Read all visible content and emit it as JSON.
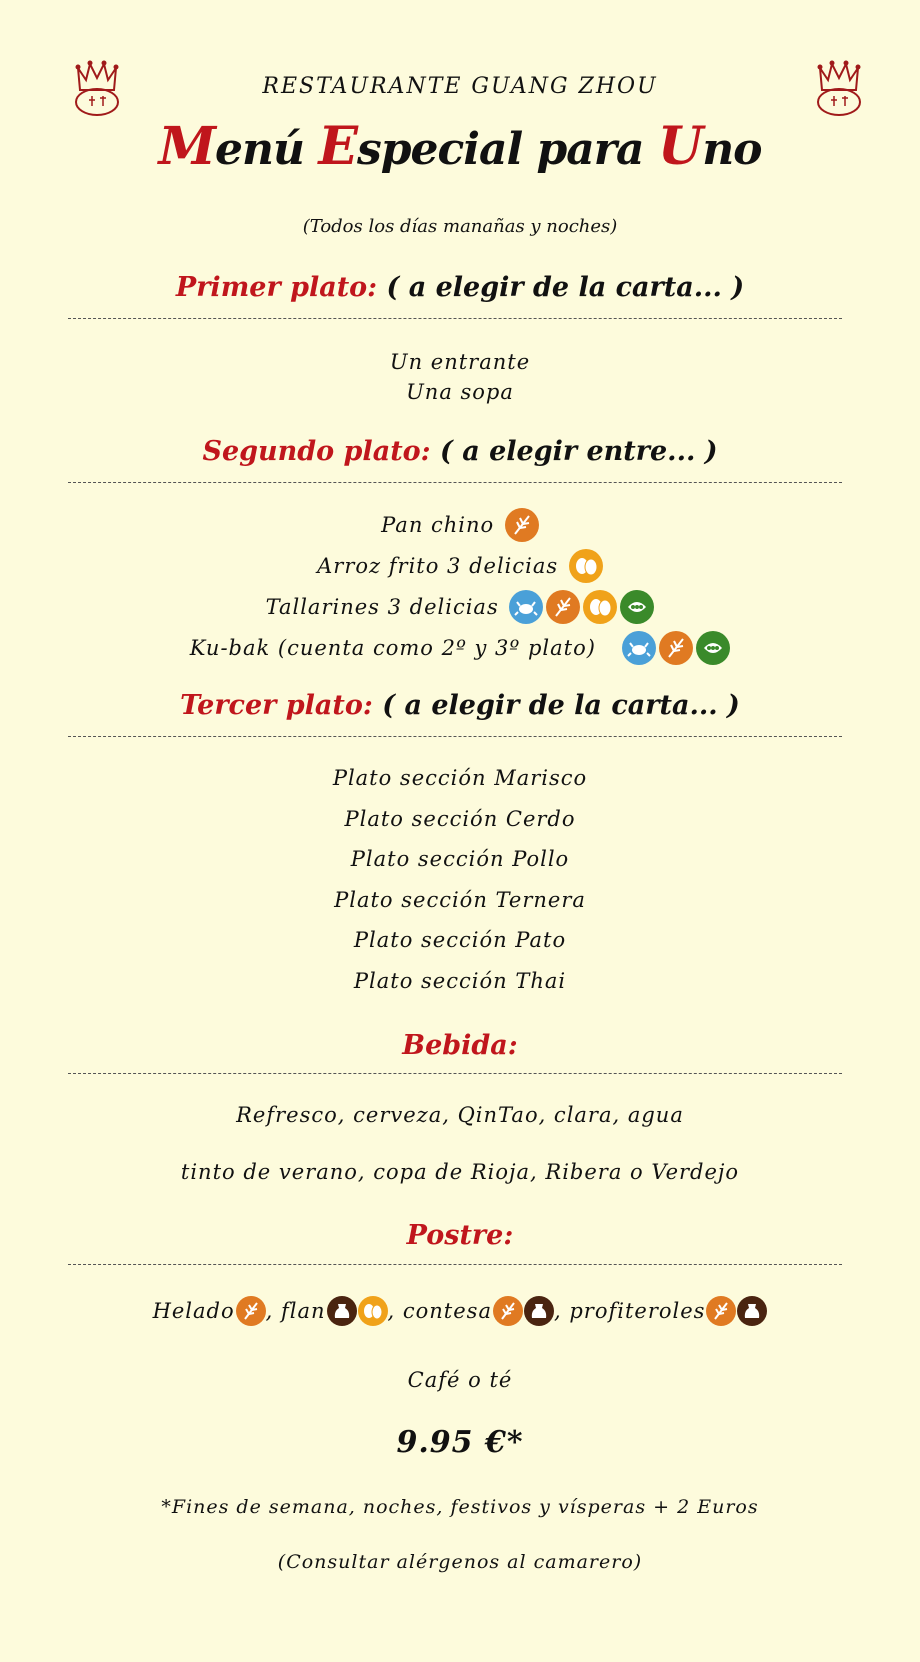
{
  "header": {
    "restaurant": "RESTAURANTE GUANG ZHOU",
    "title_parts": [
      "M",
      "enú ",
      "E",
      "special para ",
      "U",
      "no"
    ],
    "subtitle": "(Todos los días  manañas y noches)"
  },
  "sections": {
    "primer": {
      "label": "Primer plato:",
      "hint": " ( a elegir de la carta... )"
    },
    "segundo": {
      "label": "Segundo plato:",
      "hint": " ( a elegir entre... )"
    },
    "tercer": {
      "label": "Tercer plato:",
      "hint": " ( a elegir de la carta... )"
    },
    "bebida": {
      "label": "Bebida:"
    },
    "postre": {
      "label": "Postre:"
    }
  },
  "primer_items": [
    "Un entrante",
    "Una sopa"
  ],
  "segundo_items": [
    {
      "text": "Pan chino",
      "allergens": [
        "gluten-icon"
      ]
    },
    {
      "text": "Arroz frito 3 delicias",
      "allergens": [
        "egg-icon"
      ]
    },
    {
      "text": "Tallarines 3 delicias",
      "allergens": [
        "crustacean-icon",
        "gluten-icon",
        "egg-icon",
        "soy-icon"
      ]
    },
    {
      "text": "Ku-bak (cuenta como 2º y 3º plato)",
      "allergens": [
        "crustacean-icon",
        "gluten-icon",
        "soy-icon"
      ]
    }
  ],
  "tercer_items": [
    "Plato sección Marisco",
    "Plato sección Cerdo",
    "Plato sección Pollo",
    "Plato sección Ternera",
    "Plato sección Pato",
    "Plato sección Thai"
  ],
  "bebida_items": [
    "Refresco, cerveza, QinTao, clara, agua",
    "tinto de verano, copa de Rioja, Ribera o Verdejo"
  ],
  "postre": {
    "helado": "Helado",
    "flan": ", flan",
    "contesa": ", contesa",
    "profiteroles": ", profiteroles",
    "cafe": "Café o té"
  },
  "price": "9.95 €*",
  "footnote": "*Fines de semana, noches, festivos y vísperas + 2 Euros",
  "allergen_note": "(Consultar alérgenos al camarero)",
  "colors": {
    "accent": "#c0161c",
    "background": "#fdfbdc"
  }
}
